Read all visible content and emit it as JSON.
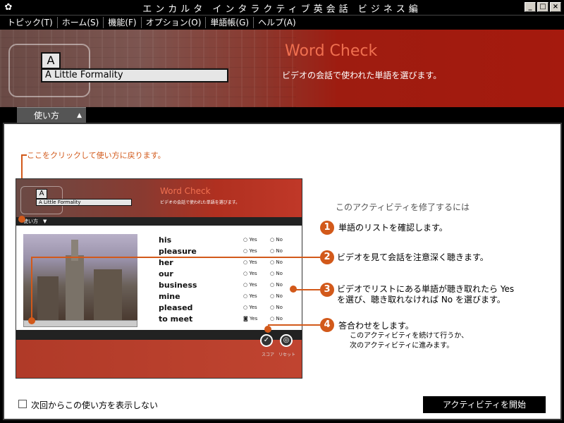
{
  "window": {
    "title": "エンカルタ インタラクティブ英会話 ビジネス編",
    "app_icon": "encarta-icon",
    "buttons": [
      "_",
      "□",
      "×"
    ]
  },
  "menu": [
    "トピック(T)",
    "ホーム(S)",
    "機能(F)",
    "オプション(O)",
    "単語帳(G)",
    "ヘルプ(A)"
  ],
  "header": {
    "unit_letter": "A",
    "unit_title": "A Little Formality",
    "activity_title": "Word Check",
    "activity_subtitle": "ビデオの会話で使われた単語を選びます。"
  },
  "tab": {
    "label": "使い方",
    "arrow": "▲"
  },
  "hint": "ここをクリックして使い方に戻ります。",
  "mini": {
    "unit_letter": "A",
    "unit_title": "A Little Formality",
    "activity_title": "Word Check",
    "activity_subtitle": "ビデオの会話で使われた単語を選びます。",
    "tab_label": "使い方　▼",
    "yes_label": "Yes",
    "no_label": "No",
    "words": [
      "his",
      "pleasure",
      "her",
      "our",
      "business",
      "mine",
      "pleased",
      "to meet"
    ],
    "score_label": "スコア",
    "reset_label": "リセット"
  },
  "steps": {
    "heading": "このアクティビティを修了するには",
    "items": [
      {
        "num": "1",
        "text": "単語のリストを確認します。"
      },
      {
        "num": "2",
        "text": "ビデオを見て会話を注意深く聴きます。"
      },
      {
        "num": "3",
        "text": "ビデオでリストにある単語が聴き取れたら Yes",
        "text2": "を選び、聴き取れなければ No を選びます。"
      },
      {
        "num": "4",
        "text": "答合わせをします。",
        "sub1": "このアクティビティを続けて行うか、",
        "sub2": "次のアクティビティに進みます。"
      }
    ]
  },
  "footer": {
    "checkbox_label": "次回からこの使い方を表示しない",
    "checkbox_checked": false,
    "start_button": "アクティビティを開始"
  },
  "colors": {
    "accent": "#d2591a",
    "banner_red": "#a51a0e",
    "title_orange": "#f07050"
  }
}
